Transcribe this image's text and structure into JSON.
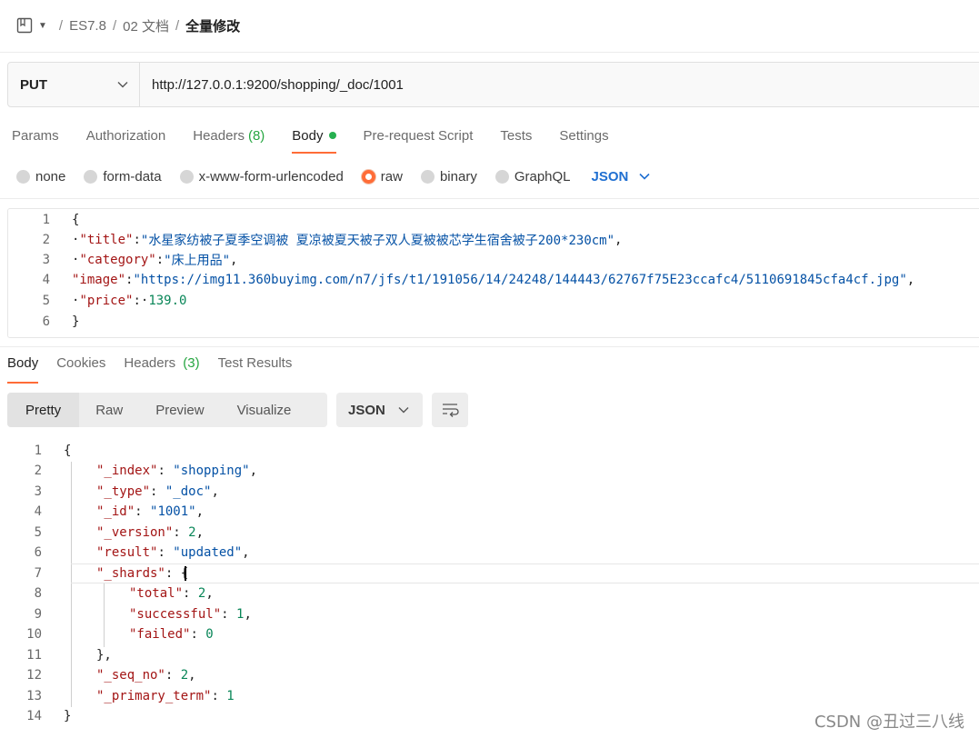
{
  "breadcrumb": {
    "items": [
      "ES7.8",
      "02 文档"
    ],
    "current": "全量修改"
  },
  "request": {
    "method": "PUT",
    "url": "http://127.0.0.1:9200/shopping/_doc/1001"
  },
  "request_tabs": [
    {
      "label": "Params"
    },
    {
      "label": "Authorization"
    },
    {
      "label": "Headers",
      "count": "(8)"
    },
    {
      "label": "Body",
      "active": true
    },
    {
      "label": "Pre-request Script"
    },
    {
      "label": "Tests"
    },
    {
      "label": "Settings"
    }
  ],
  "body_types": [
    "none",
    "form-data",
    "x-www-form-urlencoded",
    "raw",
    "binary",
    "GraphQL"
  ],
  "body_type_selected": "raw",
  "body_language": "JSON",
  "request_body": {
    "line_numbers": [
      "1",
      "2",
      "3",
      "4",
      "5",
      "6"
    ],
    "lines": {
      "l1": "{",
      "l2_key": "\"title\"",
      "l2_val": "\"水星家纺被子夏季空调被 夏凉被夏天被子双人夏被被芯学生宿舍被子200*230cm\"",
      "l3_key": "\"category\"",
      "l3_val": "\"床上用品\"",
      "l4_key": "\"image\"",
      "l4_val": "\"https://img11.360buyimg.com/n7/jfs/t1/191056/14/24248/144443/62767f75E23ccafc4/5110691845cfa4cf.jpg\"",
      "l5_key": "\"price\"",
      "l5_val": "139.0",
      "l6": "}"
    }
  },
  "response_tabs": [
    {
      "label": "Body",
      "active": true
    },
    {
      "label": "Cookies"
    },
    {
      "label": "Headers",
      "count": "(3)"
    },
    {
      "label": "Test Results"
    }
  ],
  "view_modes": [
    "Pretty",
    "Raw",
    "Preview",
    "Visualize"
  ],
  "response_format": "JSON",
  "response_body": {
    "line_numbers": [
      "1",
      "2",
      "3",
      "4",
      "5",
      "6",
      "7",
      "8",
      "9",
      "10",
      "11",
      "12",
      "13",
      "14"
    ],
    "lines": {
      "l1": "{",
      "index_key": "\"_index\"",
      "index_val": "\"shopping\"",
      "type_key": "\"_type\"",
      "type_val": "\"_doc\"",
      "id_key": "\"_id\"",
      "id_val": "\"1001\"",
      "version_key": "\"_version\"",
      "version_val": "2",
      "result_key": "\"result\"",
      "result_val": "\"updated\"",
      "shards_key": "\"_shards\"",
      "shards_open": "{",
      "total_key": "\"total\"",
      "total_val": "2",
      "successful_key": "\"successful\"",
      "successful_val": "1",
      "failed_key": "\"failed\"",
      "failed_val": "0",
      "shards_close": "},",
      "seq_key": "\"_seq_no\"",
      "seq_val": "2",
      "term_key": "\"_primary_term\"",
      "term_val": "1",
      "l14": "}"
    }
  },
  "watermark": "CSDN @丑过三八线",
  "colors": {
    "accent": "#ff6c37",
    "json_key": "#a31515",
    "json_string": "#0451a5",
    "json_number": "#098658",
    "active_dot": "#26b050",
    "language_select": "#1f6fd1"
  }
}
